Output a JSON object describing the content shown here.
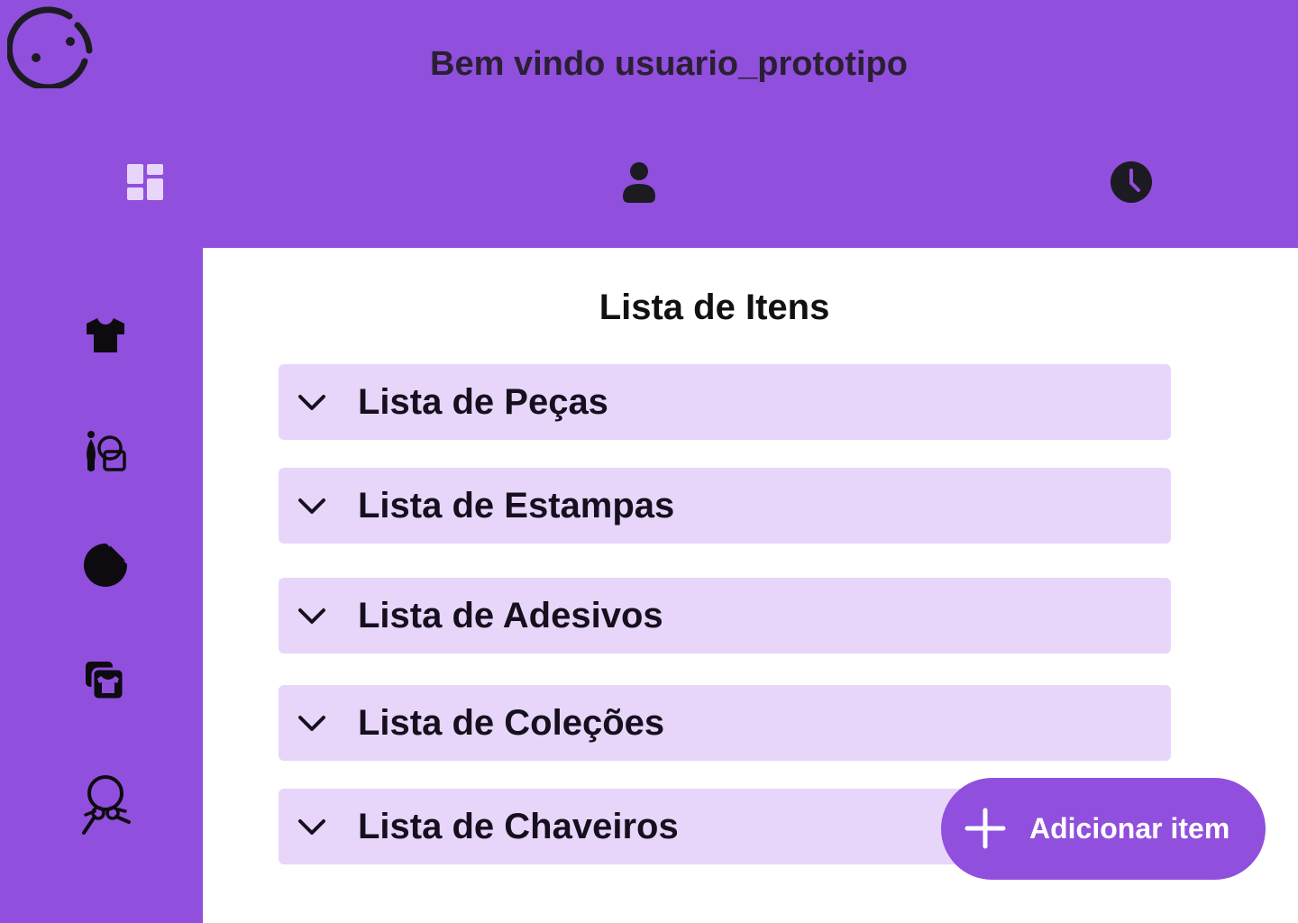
{
  "header": {
    "logo_icon": "smiley-circle-icon",
    "welcome_text": "Bem vindo usuario_prototipo"
  },
  "top_nav": [
    {
      "icon": "dashboard-icon",
      "active": true
    },
    {
      "icon": "person-icon",
      "active": false
    },
    {
      "icon": "clock-icon",
      "active": false
    }
  ],
  "sidebar": [
    {
      "icon": "tshirt-icon"
    },
    {
      "icon": "brush-shapes-icon"
    },
    {
      "icon": "sticker-icon"
    },
    {
      "icon": "collection-icon"
    },
    {
      "icon": "keychain-icon"
    }
  ],
  "main": {
    "title": "Lista de Itens",
    "lists": [
      {
        "label": "Lista de Peças"
      },
      {
        "label": "Lista de Estampas"
      },
      {
        "label": "Lista de Adesivos"
      },
      {
        "label": "Lista de Coleções"
      },
      {
        "label": "Lista de Chaveiros"
      }
    ],
    "add_button_label": "Adicionar item"
  },
  "colors": {
    "brand": "#914fdd",
    "accordion": "#e7d6fa",
    "active_nav": "#e7d6fa",
    "icon_dark": "#1c1b22"
  }
}
